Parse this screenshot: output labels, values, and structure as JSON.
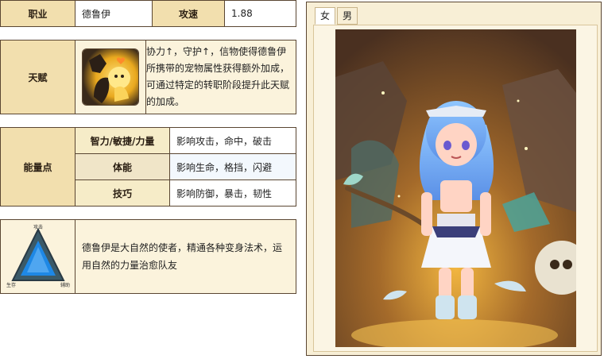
{
  "row1": {
    "class_label": "职业",
    "class_value": "德鲁伊",
    "speed_label": "攻速",
    "speed_value": "1.88"
  },
  "talent": {
    "label": "天赋",
    "icon": "druid-talent-icon",
    "description": "协力↑，守护↑，信物使得德鲁伊所携带的宠物属性获得额外加成，可通过特定的转职阶段提升此天赋的加成。"
  },
  "energy": {
    "label": "能量点",
    "rows": [
      {
        "stat": "智力/敏捷/力量",
        "effect": "影响攻击，命中，破击"
      },
      {
        "stat": "体能",
        "effect": "影响生命，格挡，闪避"
      },
      {
        "stat": "技巧",
        "effect": "影响防御，暴击，韧性"
      }
    ]
  },
  "role": {
    "triangle_icon": "role-triangle-chart",
    "triangle_labels": {
      "top": "攻击",
      "left": "生存",
      "right": "辅助"
    },
    "description": "德鲁伊是大自然的使者，精通各种变身法术，运用自然的力量治愈队友"
  },
  "gender_tabs": {
    "female": "女",
    "male": "男",
    "active": "female"
  },
  "colors": {
    "header_bg": "#f2dfae",
    "border": "#5a4632",
    "panel_bg": "#f8efd6"
  }
}
